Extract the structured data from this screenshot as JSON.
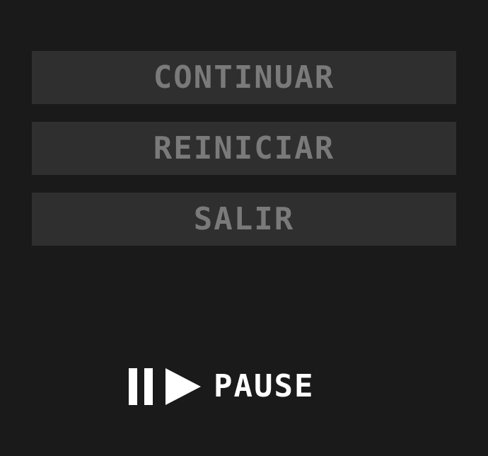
{
  "menu": {
    "items": [
      {
        "label": "CONTINUAR"
      },
      {
        "label": "REINICIAR"
      },
      {
        "label": "SALIR"
      }
    ]
  },
  "status": {
    "label": "PAUSE",
    "icons": [
      "pause-icon",
      "play-icon"
    ]
  },
  "colors": {
    "background": "#1a1a1a",
    "button_background": "#2f2f2f",
    "button_text": "#7a7a7a",
    "status_text": "#ffffff"
  }
}
